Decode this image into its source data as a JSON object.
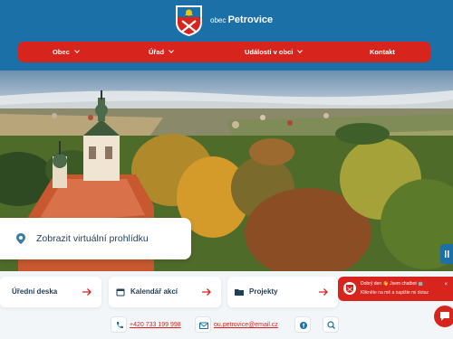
{
  "header": {
    "brand_prefix": "obec",
    "brand_name": "Petrovice",
    "colors": {
      "header_bg": "#1a70a7",
      "accent": "#d7251d"
    }
  },
  "nav": {
    "items": [
      {
        "label": "Obec",
        "has_dropdown": true
      },
      {
        "label": "Úřad",
        "has_dropdown": true
      },
      {
        "label": "Události v obci",
        "has_dropdown": true
      },
      {
        "label": "Kontakt",
        "has_dropdown": false
      }
    ]
  },
  "hero": {
    "virtual_tour_label": "Zobrazit virtuální prohlídku",
    "icon": "map-pin-icon"
  },
  "quick_links": [
    {
      "label": "Úřední deska",
      "icon": "list-icon"
    },
    {
      "label": "Kalendář akcí",
      "icon": "calendar-icon"
    },
    {
      "label": "Projekty",
      "icon": "folder-icon"
    }
  ],
  "chat": {
    "greeting": "Dobrý den 👋 Jsem chatbot 🤖",
    "subtext": "Klikněte na mě a napište mi dotaz",
    "close": "×"
  },
  "contact": {
    "phone": "+420 733 199 998",
    "email": "ou.petrovice@email.cz"
  }
}
